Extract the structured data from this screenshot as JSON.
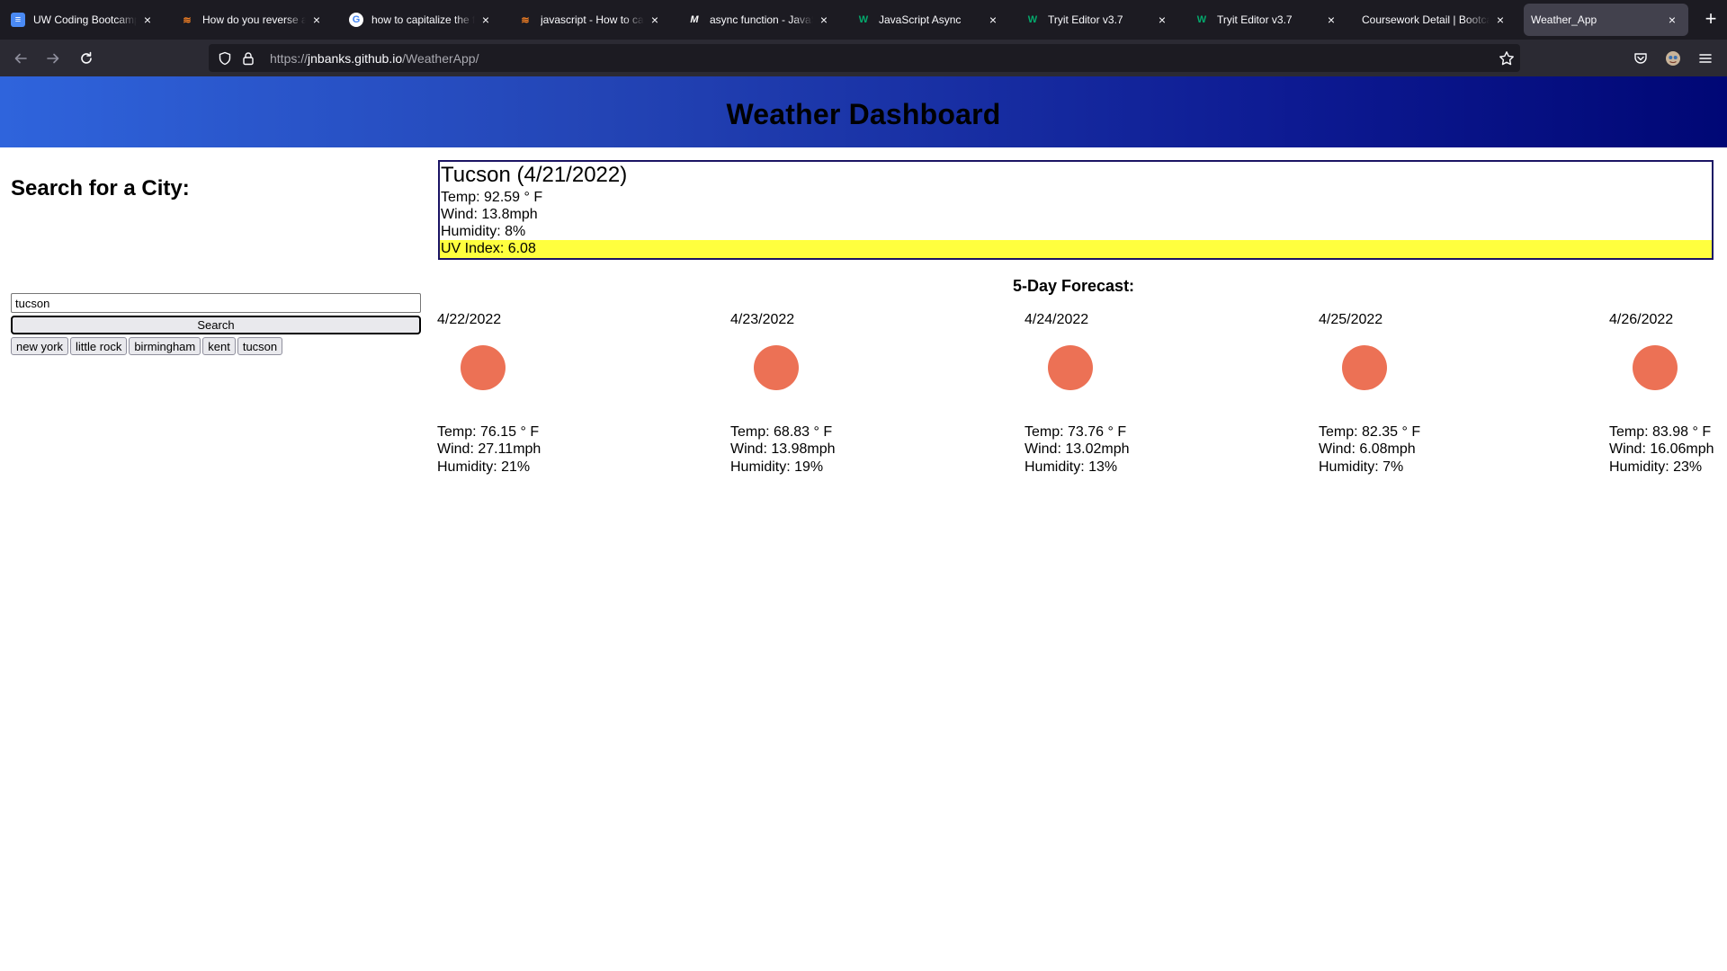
{
  "browser": {
    "tabs": [
      {
        "title": "UW Coding Bootcamp - C",
        "favicon": "doc-icon",
        "active": false
      },
      {
        "title": "How do you reverse a str",
        "favicon": "stackoverflow-icon",
        "active": false
      },
      {
        "title": "how to capitalize the first",
        "favicon": "google-icon",
        "active": false
      },
      {
        "title": "javascript - How to capita",
        "favicon": "stackoverflow-icon",
        "active": false
      },
      {
        "title": "async function - JavaScri",
        "favicon": "mdn-icon",
        "active": false
      },
      {
        "title": "JavaScript Async",
        "favicon": "w3schools-icon",
        "active": false
      },
      {
        "title": "Tryit Editor v3.7",
        "favicon": "w3schools-icon",
        "active": false
      },
      {
        "title": "Tryit Editor v3.7",
        "favicon": "w3schools-icon",
        "active": false
      },
      {
        "title": "Coursework Detail | Bootcamp",
        "favicon": "none",
        "active": false
      },
      {
        "title": "Weather_App",
        "favicon": "none",
        "active": true
      }
    ],
    "favicon_glyphs": {
      "doc": "≡",
      "so": "≋",
      "g": "G",
      "m": "M",
      "w": "W"
    },
    "close_glyph": "×",
    "newtab_glyph": "+",
    "url": {
      "prefix": "https://",
      "host": "jnbanks.github.io",
      "path": "/WeatherApp/"
    }
  },
  "app": {
    "header_title": "Weather Dashboard",
    "search_title": "Search for a City:",
    "search_value": "tucson",
    "search_button": "Search",
    "history": [
      "new york",
      "little rock",
      "birmingham",
      "kent",
      "tucson"
    ],
    "current": {
      "city_date": "Tucson (4/21/2022)",
      "temp": "Temp: 92.59 ° F",
      "wind": "Wind: 13.8mph",
      "humidity": "Humidity: 8%",
      "uv": "UV Index: 6.08"
    },
    "uv_highlight_color": "#ffff3e",
    "forecast_title": "5-Day Forecast:",
    "forecast": [
      {
        "date": "4/22/2022",
        "temp": "Temp: 76.15 ° F",
        "wind": "Wind: 27.11mph",
        "humidity": "Humidity: 21%"
      },
      {
        "date": "4/23/2022",
        "temp": "Temp: 68.83 ° F",
        "wind": "Wind: 13.98mph",
        "humidity": "Humidity: 19%"
      },
      {
        "date": "4/24/2022",
        "temp": "Temp: 73.76 ° F",
        "wind": "Wind: 13.02mph",
        "humidity": "Humidity: 13%"
      },
      {
        "date": "4/25/2022",
        "temp": "Temp: 82.35 ° F",
        "wind": "Wind: 6.08mph",
        "humidity": "Humidity: 7%"
      },
      {
        "date": "4/26/2022",
        "temp": "Temp: 83.98 ° F",
        "wind": "Wind: 16.06mph",
        "humidity": "Humidity: 23%"
      }
    ],
    "weather_icon_color": "#ec7155"
  }
}
